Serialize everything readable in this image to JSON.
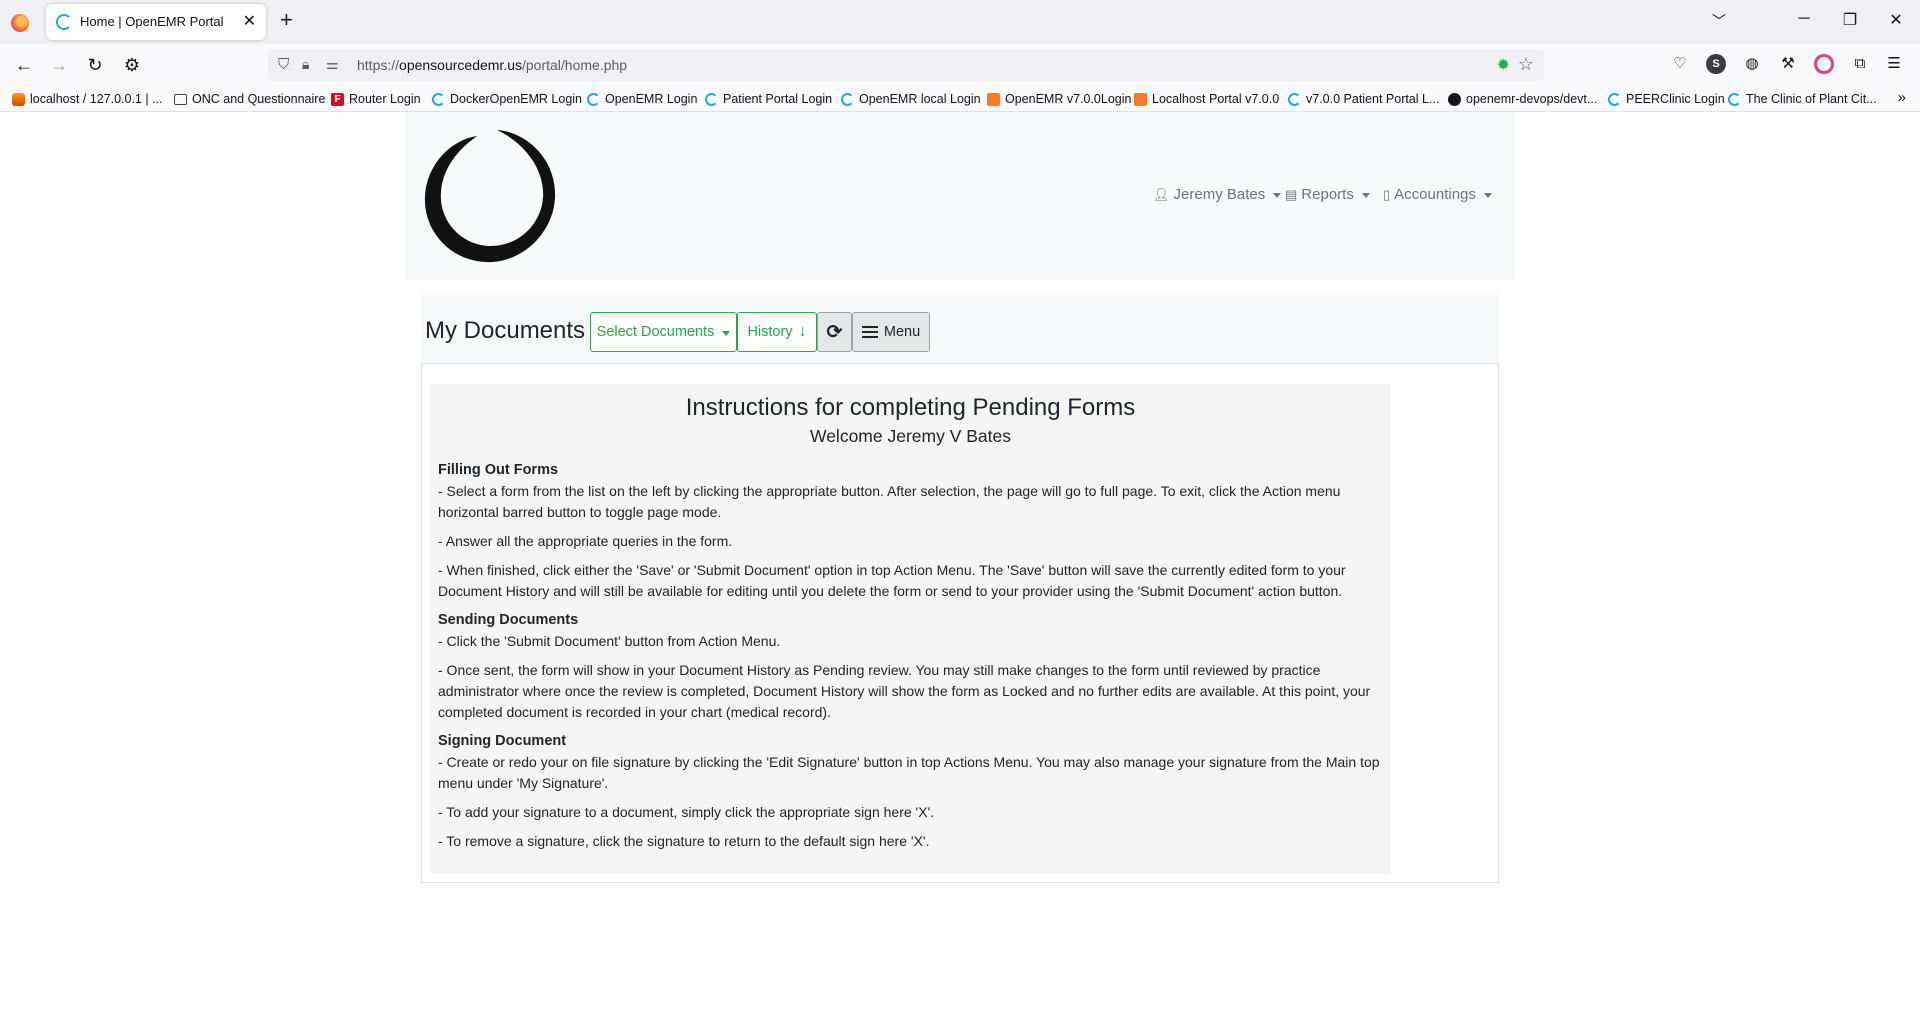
{
  "browser": {
    "tab_title": "Home | OpenEMR Portal",
    "url_host": "opensourcedemr.us",
    "url_prefix": "https://",
    "url_path": "/portal/home.php",
    "bookmarks": [
      "localhost / 127.0.0.1 | ...",
      "ONC and Questionnaire",
      "Router Login",
      "DockerOpenEMR Login",
      "OpenEMR Login",
      "Patient Portal Login",
      "OpenEMR local Login",
      "OpenEMR v7.0.0Login",
      "Localhost Portal  v7.0.0",
      "v7.0.0 Patient Portal L...",
      "openemr-devops/devt...",
      "PEERClinic Login",
      "The Clinic of Plant Cit..."
    ]
  },
  "header": {
    "user_menu": "Jeremy Bates",
    "reports_menu": "Reports",
    "accountings_menu": "Accountings"
  },
  "docs": {
    "title": "My Documents",
    "select_documents": "Select Documents",
    "history": "History",
    "menu": "Menu"
  },
  "instructions": {
    "title": "Instructions for completing Pending Forms",
    "welcome": "Welcome Jeremy V Bates",
    "sections": [
      {
        "heading": "Filling Out Forms",
        "paragraphs": [
          "- Select a form from the list on the left by clicking the appropriate button. After selection, the page will go to full page. To exit, click the Action menu horizontal barred button to toggle page mode.",
          "- Answer all the appropriate queries in the form.",
          "- When finished, click either the 'Save' or 'Submit Document' option in top Action Menu. The 'Save' button will save the currently edited form to your Document History and will still be available for editing until you delete the form or send to your provider using the 'Submit Document' action button."
        ]
      },
      {
        "heading": "Sending Documents",
        "paragraphs": [
          "- Click the 'Submit Document' button from Action Menu.",
          "- Once sent, the form will show in your Document History as Pending review. You may still make changes to the form until reviewed by practice administrator where once the review is completed, Document History will show the form as Locked and no further edits are available. At this point, your completed document is recorded in your chart (medical record)."
        ]
      },
      {
        "heading": "Signing Document",
        "paragraphs": [
          "- Create or redo your on file signature by clicking the 'Edit Signature' button in top Actions Menu. You may also manage your signature from the Main top menu under 'My Signature'.",
          "- To add your signature to a document, simply click the appropriate sign here 'X'.",
          "- To remove a signature, click the signature to return to the default sign here 'X'."
        ]
      }
    ]
  },
  "colors": {
    "success": "#28a745",
    "muted": "#6c757d",
    "panel": "#f8f9fa"
  }
}
